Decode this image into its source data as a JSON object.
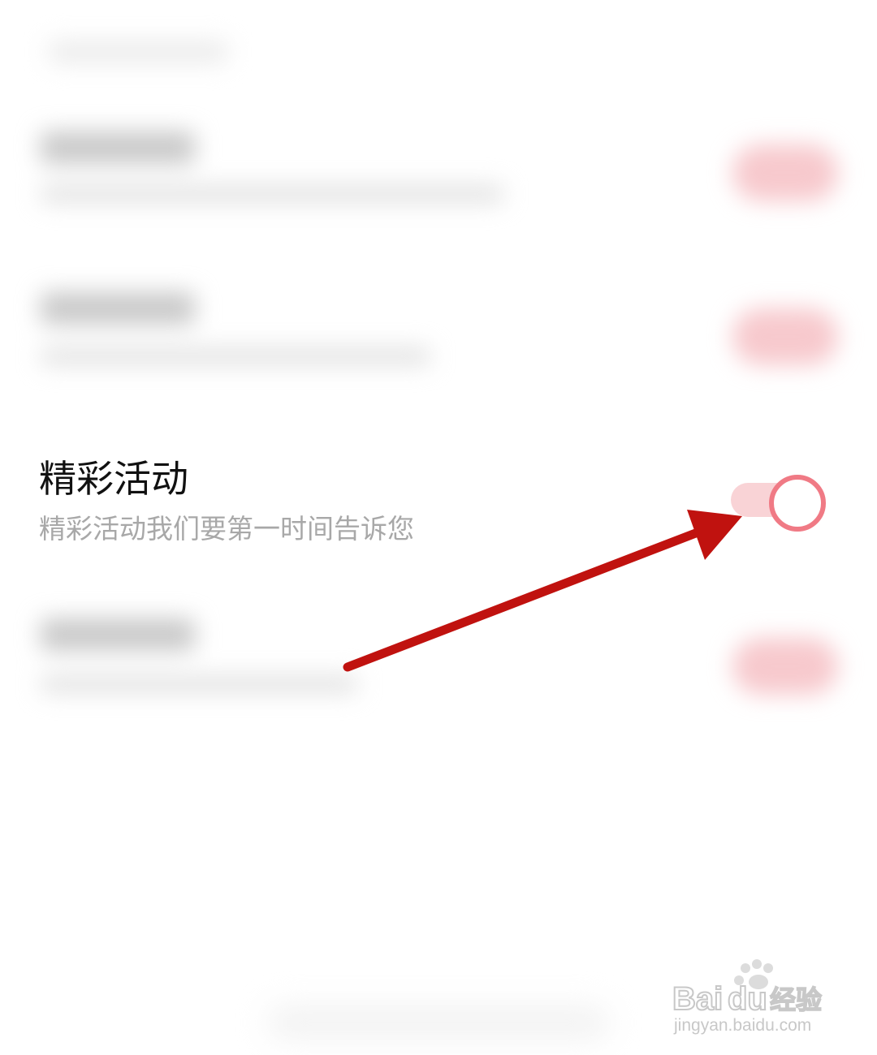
{
  "row": {
    "title": "精彩活动",
    "subtitle": "精彩活动我们要第一时间告诉您",
    "toggle_state": "on",
    "toggle_color": "#f07a85",
    "toggle_track_color": "#f9d3d6"
  },
  "annotation": {
    "arrow_color": "#c0120f"
  },
  "watermark": {
    "brand": "Baidu经验",
    "url": "jingyan.baidu.com"
  }
}
